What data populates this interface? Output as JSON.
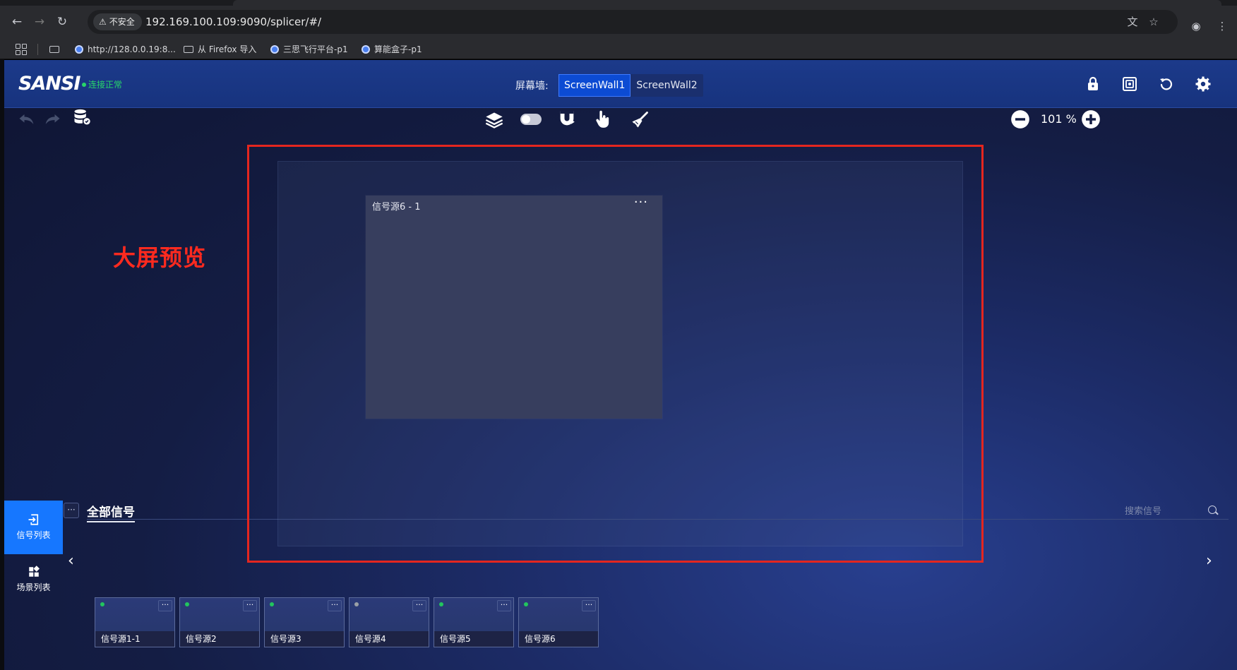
{
  "browser": {
    "url_security": "不安全",
    "url": "192.169.100.109:9090/splicer/#/",
    "bookmarks": [
      {
        "label": "http://128.0.0.19:8...",
        "type": "site"
      },
      {
        "label": "从 Firefox 导入",
        "type": "folder"
      },
      {
        "label": "三思飞行平台-p1",
        "type": "site"
      },
      {
        "label": "算能盒子-p1",
        "type": "site"
      }
    ]
  },
  "header": {
    "logo": "SANSI",
    "connection_status": "连接正常",
    "screen_wall_label": "屏幕墙:",
    "screen_walls": [
      {
        "label": "ScreenWall1",
        "active": true
      },
      {
        "label": "ScreenWall2",
        "active": false
      }
    ],
    "icons": [
      "lock-icon",
      "screen-capture-icon",
      "refresh-icon",
      "settings-icon"
    ]
  },
  "toolbar": {
    "zoom": "101 %",
    "icons": [
      "undo-icon",
      "redo-icon",
      "database-icon",
      "layers-icon",
      "toggle-switch",
      "magnet-icon",
      "hand-pointer-icon",
      "broom-icon",
      "zoom-out-icon",
      "zoom-in-icon"
    ]
  },
  "preview": {
    "annotation": "大屏预览",
    "window": {
      "title": "信号源6 - 1",
      "menu": "···"
    }
  },
  "sidebar": {
    "items": [
      {
        "label": "信号列表",
        "active": true
      },
      {
        "label": "场景列表",
        "active": false
      }
    ]
  },
  "signals": {
    "more": "···",
    "title": "全部信号",
    "search_placeholder": "搜索信号",
    "items": [
      {
        "label": "信号源1-1",
        "status": "online",
        "more": "···"
      },
      {
        "label": "信号源2",
        "status": "online",
        "more": "···"
      },
      {
        "label": "信号源3",
        "status": "online",
        "more": "···"
      },
      {
        "label": "信号源4",
        "status": "offline",
        "more": "···"
      },
      {
        "label": "信号源5",
        "status": "online",
        "more": "···"
      },
      {
        "label": "信号源6",
        "status": "online",
        "more": "···"
      }
    ]
  },
  "colors": {
    "accent": "#1677ff",
    "online": "#22c55e",
    "offline": "#9aa0a6",
    "annotation": "#e4261f"
  }
}
